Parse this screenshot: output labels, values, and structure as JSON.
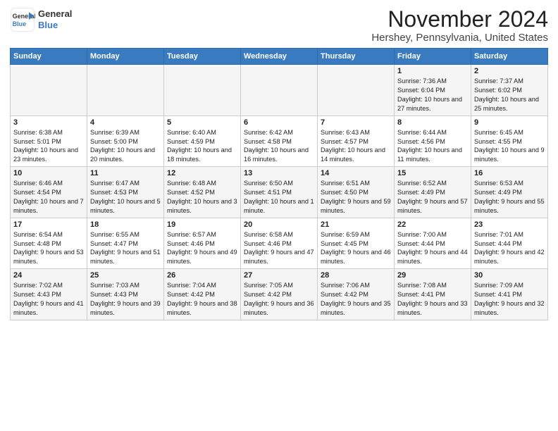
{
  "header": {
    "logo_line1": "General",
    "logo_line2": "Blue",
    "title": "November 2024",
    "location": "Hershey, Pennsylvania, United States"
  },
  "weekdays": [
    "Sunday",
    "Monday",
    "Tuesday",
    "Wednesday",
    "Thursday",
    "Friday",
    "Saturday"
  ],
  "weeks": [
    [
      {
        "day": "",
        "info": ""
      },
      {
        "day": "",
        "info": ""
      },
      {
        "day": "",
        "info": ""
      },
      {
        "day": "",
        "info": ""
      },
      {
        "day": "",
        "info": ""
      },
      {
        "day": "1",
        "info": "Sunrise: 7:36 AM\nSunset: 6:04 PM\nDaylight: 10 hours and 27 minutes."
      },
      {
        "day": "2",
        "info": "Sunrise: 7:37 AM\nSunset: 6:02 PM\nDaylight: 10 hours and 25 minutes."
      }
    ],
    [
      {
        "day": "3",
        "info": "Sunrise: 6:38 AM\nSunset: 5:01 PM\nDaylight: 10 hours and 23 minutes."
      },
      {
        "day": "4",
        "info": "Sunrise: 6:39 AM\nSunset: 5:00 PM\nDaylight: 10 hours and 20 minutes."
      },
      {
        "day": "5",
        "info": "Sunrise: 6:40 AM\nSunset: 4:59 PM\nDaylight: 10 hours and 18 minutes."
      },
      {
        "day": "6",
        "info": "Sunrise: 6:42 AM\nSunset: 4:58 PM\nDaylight: 10 hours and 16 minutes."
      },
      {
        "day": "7",
        "info": "Sunrise: 6:43 AM\nSunset: 4:57 PM\nDaylight: 10 hours and 14 minutes."
      },
      {
        "day": "8",
        "info": "Sunrise: 6:44 AM\nSunset: 4:56 PM\nDaylight: 10 hours and 11 minutes."
      },
      {
        "day": "9",
        "info": "Sunrise: 6:45 AM\nSunset: 4:55 PM\nDaylight: 10 hours and 9 minutes."
      }
    ],
    [
      {
        "day": "10",
        "info": "Sunrise: 6:46 AM\nSunset: 4:54 PM\nDaylight: 10 hours and 7 minutes."
      },
      {
        "day": "11",
        "info": "Sunrise: 6:47 AM\nSunset: 4:53 PM\nDaylight: 10 hours and 5 minutes."
      },
      {
        "day": "12",
        "info": "Sunrise: 6:48 AM\nSunset: 4:52 PM\nDaylight: 10 hours and 3 minutes."
      },
      {
        "day": "13",
        "info": "Sunrise: 6:50 AM\nSunset: 4:51 PM\nDaylight: 10 hours and 1 minute."
      },
      {
        "day": "14",
        "info": "Sunrise: 6:51 AM\nSunset: 4:50 PM\nDaylight: 9 hours and 59 minutes."
      },
      {
        "day": "15",
        "info": "Sunrise: 6:52 AM\nSunset: 4:49 PM\nDaylight: 9 hours and 57 minutes."
      },
      {
        "day": "16",
        "info": "Sunrise: 6:53 AM\nSunset: 4:49 PM\nDaylight: 9 hours and 55 minutes."
      }
    ],
    [
      {
        "day": "17",
        "info": "Sunrise: 6:54 AM\nSunset: 4:48 PM\nDaylight: 9 hours and 53 minutes."
      },
      {
        "day": "18",
        "info": "Sunrise: 6:55 AM\nSunset: 4:47 PM\nDaylight: 9 hours and 51 minutes."
      },
      {
        "day": "19",
        "info": "Sunrise: 6:57 AM\nSunset: 4:46 PM\nDaylight: 9 hours and 49 minutes."
      },
      {
        "day": "20",
        "info": "Sunrise: 6:58 AM\nSunset: 4:46 PM\nDaylight: 9 hours and 47 minutes."
      },
      {
        "day": "21",
        "info": "Sunrise: 6:59 AM\nSunset: 4:45 PM\nDaylight: 9 hours and 46 minutes."
      },
      {
        "day": "22",
        "info": "Sunrise: 7:00 AM\nSunset: 4:44 PM\nDaylight: 9 hours and 44 minutes."
      },
      {
        "day": "23",
        "info": "Sunrise: 7:01 AM\nSunset: 4:44 PM\nDaylight: 9 hours and 42 minutes."
      }
    ],
    [
      {
        "day": "24",
        "info": "Sunrise: 7:02 AM\nSunset: 4:43 PM\nDaylight: 9 hours and 41 minutes."
      },
      {
        "day": "25",
        "info": "Sunrise: 7:03 AM\nSunset: 4:43 PM\nDaylight: 9 hours and 39 minutes."
      },
      {
        "day": "26",
        "info": "Sunrise: 7:04 AM\nSunset: 4:42 PM\nDaylight: 9 hours and 38 minutes."
      },
      {
        "day": "27",
        "info": "Sunrise: 7:05 AM\nSunset: 4:42 PM\nDaylight: 9 hours and 36 minutes."
      },
      {
        "day": "28",
        "info": "Sunrise: 7:06 AM\nSunset: 4:42 PM\nDaylight: 9 hours and 35 minutes."
      },
      {
        "day": "29",
        "info": "Sunrise: 7:08 AM\nSunset: 4:41 PM\nDaylight: 9 hours and 33 minutes."
      },
      {
        "day": "30",
        "info": "Sunrise: 7:09 AM\nSunset: 4:41 PM\nDaylight: 9 hours and 32 minutes."
      }
    ]
  ]
}
